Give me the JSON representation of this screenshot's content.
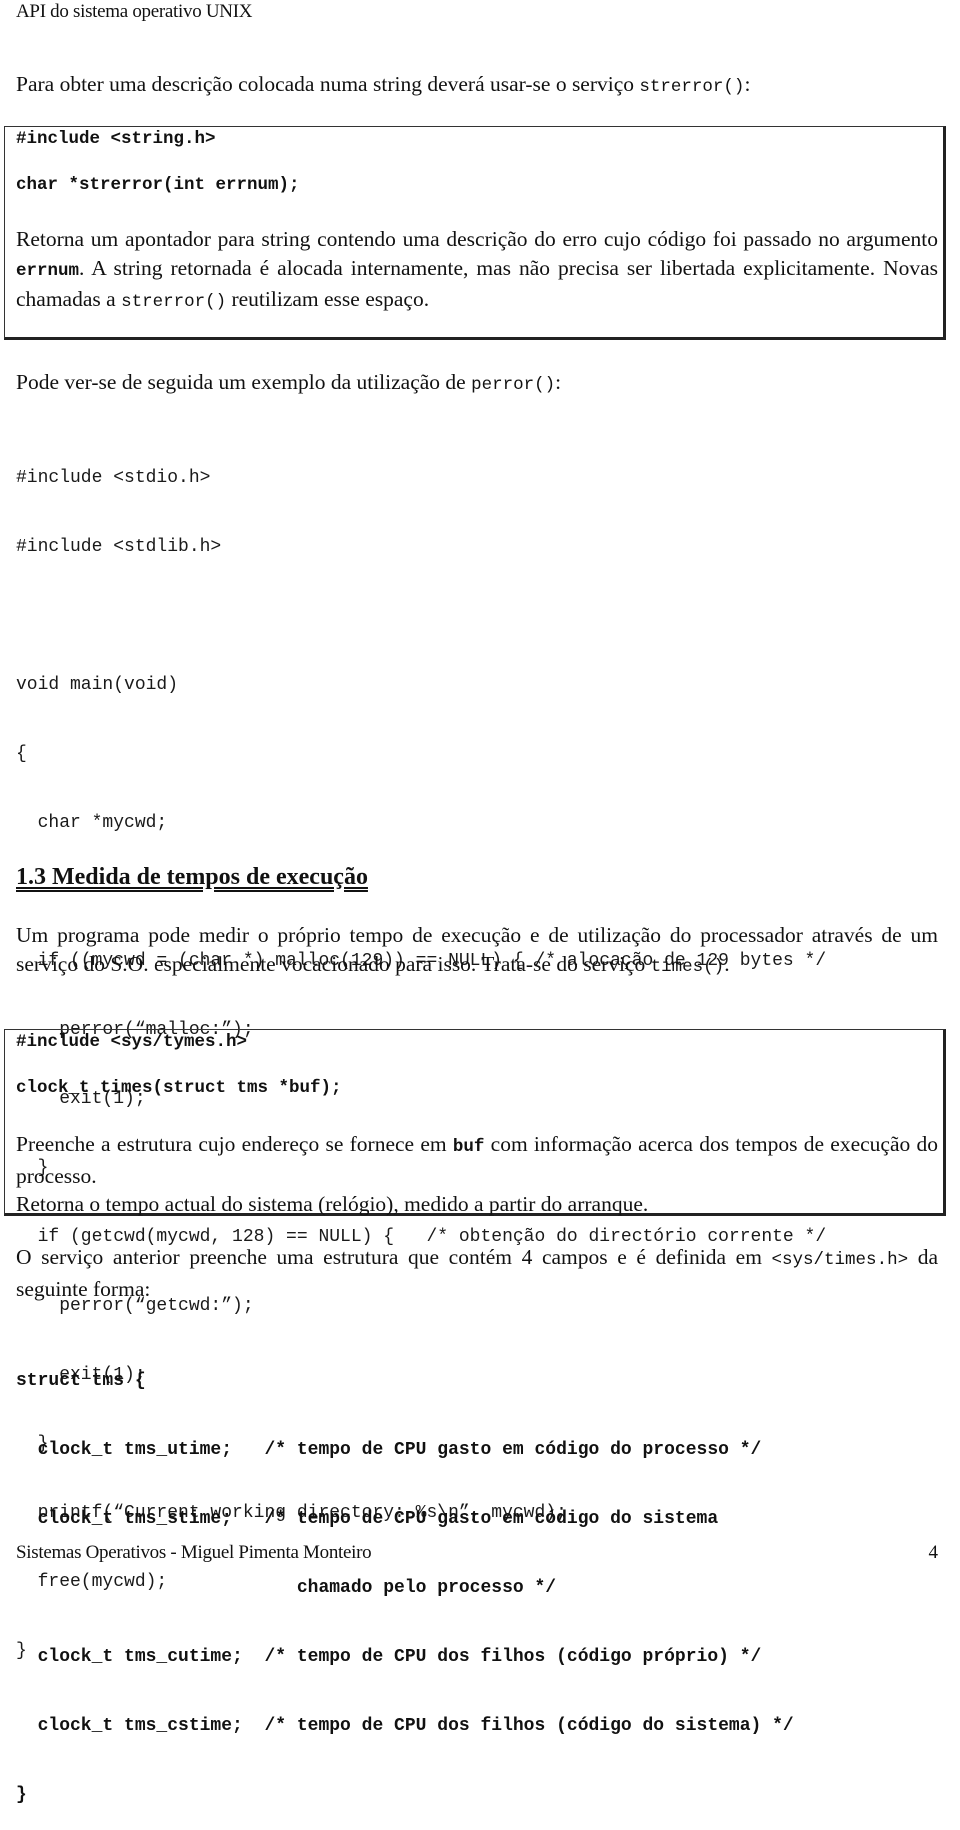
{
  "header": {
    "title": "API do sistema operativo UNIX"
  },
  "intro": {
    "text_before": "Para obter uma descrição colocada numa string deverá usar-se o serviço ",
    "code": "strerror()",
    "text_after": ":"
  },
  "strerror_box": {
    "include": "#include <string.h>",
    "signature": "char *strerror(int errnum);",
    "desc_1": "Retorna um apontador para string contendo uma descrição do erro cujo código foi passado no argumento ",
    "desc_arg": "errnum",
    "desc_2": ".  A string retornada é alocada internamente, mas não precisa ser libertada explicitamente.  Novas chamadas a ",
    "desc_code": "strerror()",
    "desc_3": " reutilizam esse espaço."
  },
  "example_intro": {
    "text_before": "Pode ver-se de seguida um exemplo da utilização de ",
    "code": "perror()",
    "text_after": ":"
  },
  "example_code": {
    "lines": [
      "#include <stdio.h>",
      "#include <stdlib.h>",
      "",
      "void main(void)",
      "{",
      "  char *mycwd;",
      "",
      "  if ((mycwd = (char *) malloc(129)) == NULL) { /* alocação de 129 bytes */",
      "    perror(“malloc:”);",
      "    exit(1);",
      "  }",
      "  if (getcwd(mycwd, 128) == NULL) {   /* obtenção do directório corrente */",
      "    perror(“getcwd:”);",
      "    exit(1);",
      "  }",
      "  printf(“Current working directory: %s\\n”, mycwd);",
      "  free(mycwd);",
      "}"
    ]
  },
  "section": {
    "title": "1.3 Medida de tempos de execução",
    "para_text": "Um programa pode medir o próprio tempo de execução e de utilização do processador através de um serviço do S.O. especialmente vocacionado para isso.  Trata-se do serviço ",
    "para_code": "times()",
    "para_end": "."
  },
  "times_box": {
    "include": "#include <sys/tymes.h>",
    "signature": "clock_t times(struct tms *buf);",
    "desc_1": "Preenche a estrutura cujo endereço se fornece em ",
    "desc_arg": "buf",
    "desc_2": " com informação acerca dos tempos de execução do processo.",
    "desc_3": "Retorna o tempo actual do sistema (relógio), medido a partir do arranque."
  },
  "struct_intro": {
    "text": "O serviço anterior preenche uma estrutura que contém 4 campos e é definida em ",
    "code": "<sys/times.h>",
    "text_after": " da seguinte forma:"
  },
  "struct_code": {
    "lines": [
      "struct tms {",
      "  clock_t tms_utime;   /* tempo de CPU gasto em código do processo */",
      "  clock_t tms_stime;   /* tempo de CPU gasto em código do sistema",
      "                          chamado pelo processo */",
      "  clock_t tms_cutime;  /* tempo de CPU dos filhos (código próprio) */",
      "  clock_t tms_cstime;  /* tempo de CPU dos filhos (código do sistema) */",
      "}"
    ]
  },
  "footer": {
    "left": "Sistemas Operativos - Miguel Pimenta Monteiro",
    "page_number": "4"
  }
}
